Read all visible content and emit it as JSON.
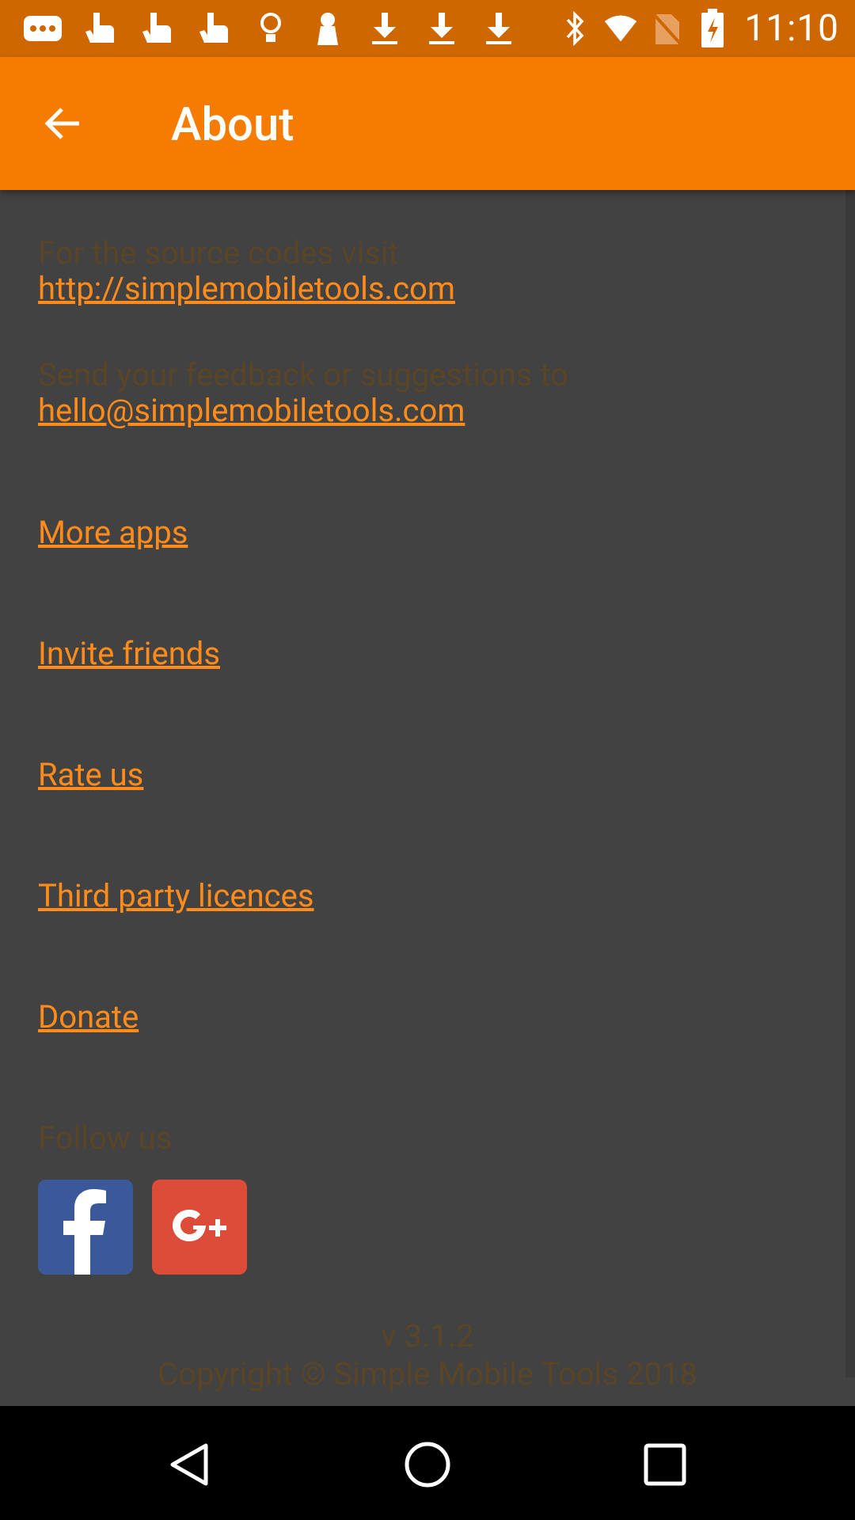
{
  "status_bar": {
    "time": "11:10",
    "left_icons": [
      "message-icon",
      "touch-icon",
      "touch-icon",
      "touch-icon",
      "lightbulb-icon",
      "keyhole-icon",
      "download-icon",
      "download-icon",
      "download-icon"
    ],
    "right_icons": [
      "bluetooth-icon",
      "wifi-icon",
      "no-sim-icon",
      "battery-charging-icon"
    ],
    "background": "#cf6700"
  },
  "app_bar": {
    "title": "About",
    "background": "#f57c00"
  },
  "about": {
    "source_text": "For the source codes visit",
    "source_link": "http://simplemobiletools.com",
    "feedback_text": "Send your feedback or suggestions to",
    "feedback_email": "hello@simplemobiletools.com",
    "links": [
      "More apps",
      "Invite friends",
      "Rate us",
      "Third party licences",
      "Donate"
    ],
    "follow_us": "Follow us",
    "social": [
      "facebook",
      "google-plus"
    ],
    "version": "v 3.1.2",
    "copyright": "Copyright © Simple Mobile Tools 2018"
  },
  "colors": {
    "accent": "#ff8c1a",
    "dim_text": "#5a4526",
    "background": "#424242"
  }
}
